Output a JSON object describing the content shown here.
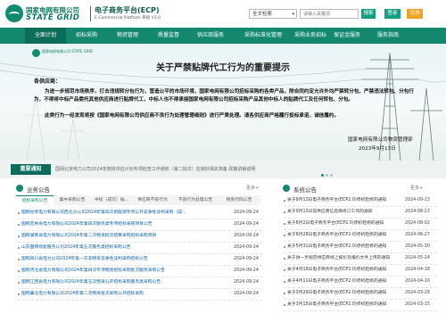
{
  "header": {
    "brand_cn": "国家电网有限公司",
    "brand_en": "STATE GRID",
    "platform_cn": "电子商务平台(ECP)",
    "platform_en": "E-Commercial Platform 系统 V3.0",
    "search_scope": "全文检索",
    "search_placeholder": "请输入关键词",
    "search_button": "搜索",
    "login_button": "登录",
    "register_button": "注册"
  },
  "nav": [
    "全面计划",
    "招标采购",
    "物资管理",
    "质量监督",
    "供应商服务",
    "采购标准化管理",
    "采购业务招标",
    "保证金服务",
    "服务指南"
  ],
  "banner": {
    "brand": "国家电网有限公司 STATE GRID",
    "title": "关于严禁贴牌代工行为的重要提示",
    "salute": "各供应商：",
    "p1": "为进一步规范市场秩序，打击违规转分包行为，营造公平的市场环境，国家电网有限公司招标采购的各类产品，除合同约定允许外均严禁转分包，严禁违法转包、分包行为，不得将中标产品委托其他供应商进行贴牌代工，中标人也不得承接国家电网有限公司招标采购产品其他中标人的贴牌代工及任何转包、分包。",
    "p2": "此类行为一经发现将按《国家电网有限公司供应商不良行为处理管理细则》进行严肃处理。请各供应商严格履行投标承诺，诚信履约。",
    "sign_org": "国家电网有限公司物资管理部",
    "sign_date": "2023年9月13日"
  },
  "notice": {
    "label": "重要通知",
    "text": "国网北京电力公司2024年物资供应计划专项检查工作通知（第二批次）应做好相关准备 政策讲解说明"
  },
  "business": {
    "title": "业务公告",
    "more": "更多+",
    "tabs": [
      "招标采购公告",
      "集中采购公告",
      "中标（成交）候...",
      "供应商不良行为",
      "不良行为处理公告",
      "物资代码公告"
    ],
    "rows": [
      {
        "title": "国网甘肃电力有限公司西北分公司2024年第四次新能源专项公开竞争性谈判采购（成...",
        "date": "2024-09-24"
      },
      {
        "title": "国网吉林省电力有限公司2024年第四次服务类专项招标采购项目公告",
        "date": "2024-09-24"
      },
      {
        "title": "国网湖南省电力有限公司2024年第二次物资批次结算采购招标采购项目",
        "date": "2024-09-24"
      },
      {
        "title": "山东国网综能服务公司2024年第五次服务类招标采购公告",
        "date": "2024-09-24"
      },
      {
        "title": "国网四川省电力公司2024年第一次非物资竞争性谈判采购招标公告",
        "date": "2024-09-24"
      },
      {
        "title": "国网河北省电力有限公司2024年第四次专项物资招标采购批次服务采购公告",
        "date": "2024-09-24"
      },
      {
        "title": "国网江西省电力有限公司2024年第五次物资公开招标采购服务类采购公告",
        "date": "2024-09-24"
      },
      {
        "title": "国网冀北电力有限公司2024年第二次物资批次采购公开招标采购",
        "date": "2024-09-24"
      }
    ]
  },
  "system": {
    "title": "系统公告",
    "more": "更多+",
    "rows": [
      {
        "title": "关于9月13日电子商务平台(ECP2.0)停机检修的通知",
        "date": "2024-09-13"
      },
      {
        "title": "关于9月13日前供应商信息库修订工作的通知",
        "date": "2024-08-23"
      },
      {
        "title": "关于8月2日电子商务平台(ECP2.0)停机检修的通知",
        "date": "2024-08-02"
      },
      {
        "title": "关于6月28日电子商务平台(ECP2.0)停机检修的通知",
        "date": "2024-06-27"
      },
      {
        "title": "关于5月31日电子商务平台(ECP2.0)停机检修的通知",
        "date": "2024-05-30"
      },
      {
        "title": "关于进一步规范供应商线上报价及报价文件上传的通知",
        "date": "2024-05-24"
      },
      {
        "title": "关于4月19日电子商务平台(ECP2.0)停机检修的通知",
        "date": "2024-04-18"
      },
      {
        "title": "关于4月11日电子商务平台(ECP2.0)停机检修的通知",
        "date": "2024-04-10"
      },
      {
        "title": "关于3月29日电子商务平台(ECP2.0)停机检修的通知",
        "date": "2024-03-28"
      },
      {
        "title": "关于3月15日电子商务平台(ECP2.0)停机检修的通知",
        "date": "2024-03-15"
      }
    ]
  },
  "colors": {
    "primary": "#13886f",
    "nav_active": "#0c6e58",
    "register": "#f0a323",
    "notice_label": "#0d6c5a"
  }
}
